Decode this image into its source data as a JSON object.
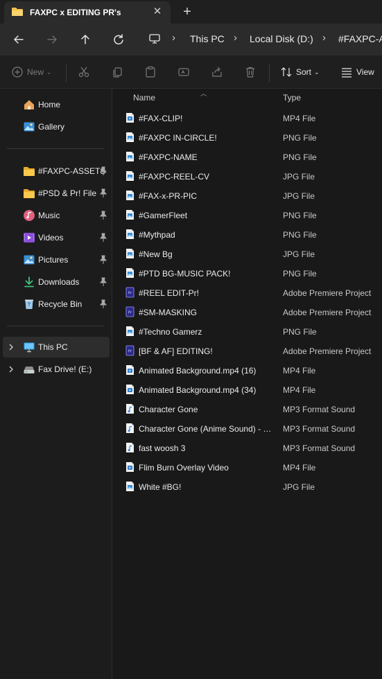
{
  "tab": {
    "title": "FAXPC x EDITING PR's",
    "close_glyph": "✕",
    "new_tab_glyph": "+"
  },
  "breadcrumbs": [
    "This PC",
    "Local Disk (D:)",
    "#FAXPC-A"
  ],
  "toolbar": {
    "new_label": "New",
    "sort_label": "Sort",
    "view_label": "View"
  },
  "sidebar": {
    "top": [
      {
        "label": "Home",
        "icon": "home-icon"
      },
      {
        "label": "Gallery",
        "icon": "gallery-icon"
      }
    ],
    "quick": [
      {
        "label": "#FAXPC-ASSETS",
        "icon": "folder-icon"
      },
      {
        "label": "#PSD & Pr! File",
        "icon": "folder-icon"
      },
      {
        "label": "Music",
        "icon": "music-icon"
      },
      {
        "label": "Videos",
        "icon": "videos-icon"
      },
      {
        "label": "Pictures",
        "icon": "pictures-icon"
      },
      {
        "label": "Downloads",
        "icon": "downloads-icon"
      },
      {
        "label": "Recycle Bin",
        "icon": "recycle-bin-icon"
      }
    ],
    "drives": [
      {
        "label": "This PC",
        "icon": "pc-icon",
        "selected": true
      },
      {
        "label": "Fax Drive! (E:)",
        "icon": "drive-icon",
        "selected": false
      }
    ]
  },
  "columns": {
    "name": "Name",
    "type": "Type"
  },
  "files": [
    {
      "name": "#FAX-CLIP!",
      "type": "MP4 File",
      "icon": "video-file-icon"
    },
    {
      "name": "#FAXPC IN-CIRCLE!",
      "type": "PNG File",
      "icon": "image-file-icon"
    },
    {
      "name": "#FAXPC-NAME",
      "type": "PNG File",
      "icon": "image-file-icon"
    },
    {
      "name": "#FAXPC-REEL-CV",
      "type": "JPG File",
      "icon": "image-file-icon"
    },
    {
      "name": "#FAX-x-PR-PIC",
      "type": "JPG File",
      "icon": "image-file-icon"
    },
    {
      "name": "#GamerFleet",
      "type": "PNG File",
      "icon": "image-file-icon"
    },
    {
      "name": "#Mythpad",
      "type": "PNG File",
      "icon": "image-file-icon"
    },
    {
      "name": "#New Bg",
      "type": "JPG File",
      "icon": "image-file-icon"
    },
    {
      "name": "#PTD BG-MUSIC PACK!",
      "type": "PNG File",
      "icon": "image-file-icon"
    },
    {
      "name": "#REEL EDIT-Pr!",
      "type": "Adobe Premiere Project",
      "icon": "premiere-file-icon"
    },
    {
      "name": "#SM-MASKING",
      "type": "Adobe Premiere Project",
      "icon": "premiere-file-icon"
    },
    {
      "name": "#Techno Gamerz",
      "type": "PNG File",
      "icon": "image-file-icon"
    },
    {
      "name": "[BF & AF] EDITING!",
      "type": "Adobe Premiere Project",
      "icon": "premiere-file-icon"
    },
    {
      "name": "Animated Background.mp4 (16)",
      "type": "MP4 File",
      "icon": "video-file-icon"
    },
    {
      "name": "Animated Background.mp4 (34)",
      "type": "MP4 File",
      "icon": "video-file-icon"
    },
    {
      "name": "Character Gone",
      "type": "MP3 Format Sound",
      "icon": "audio-file-icon"
    },
    {
      "name": "Character Gone (Anime Sound) - S...",
      "type": "MP3 Format Sound",
      "icon": "audio-file-icon"
    },
    {
      "name": "fast woosh 3",
      "type": "MP3 Format Sound",
      "icon": "audio-file-icon"
    },
    {
      "name": "Flim Burn Overlay Video",
      "type": "MP4 File",
      "icon": "video-file-icon"
    },
    {
      "name": "White #BG!",
      "type": "JPG File",
      "icon": "image-file-icon"
    }
  ],
  "colors": {
    "accent": "#4cc2ff",
    "folder": "#f4c14b",
    "premiere": "#2a2a8c",
    "home": "#e8a35a"
  }
}
